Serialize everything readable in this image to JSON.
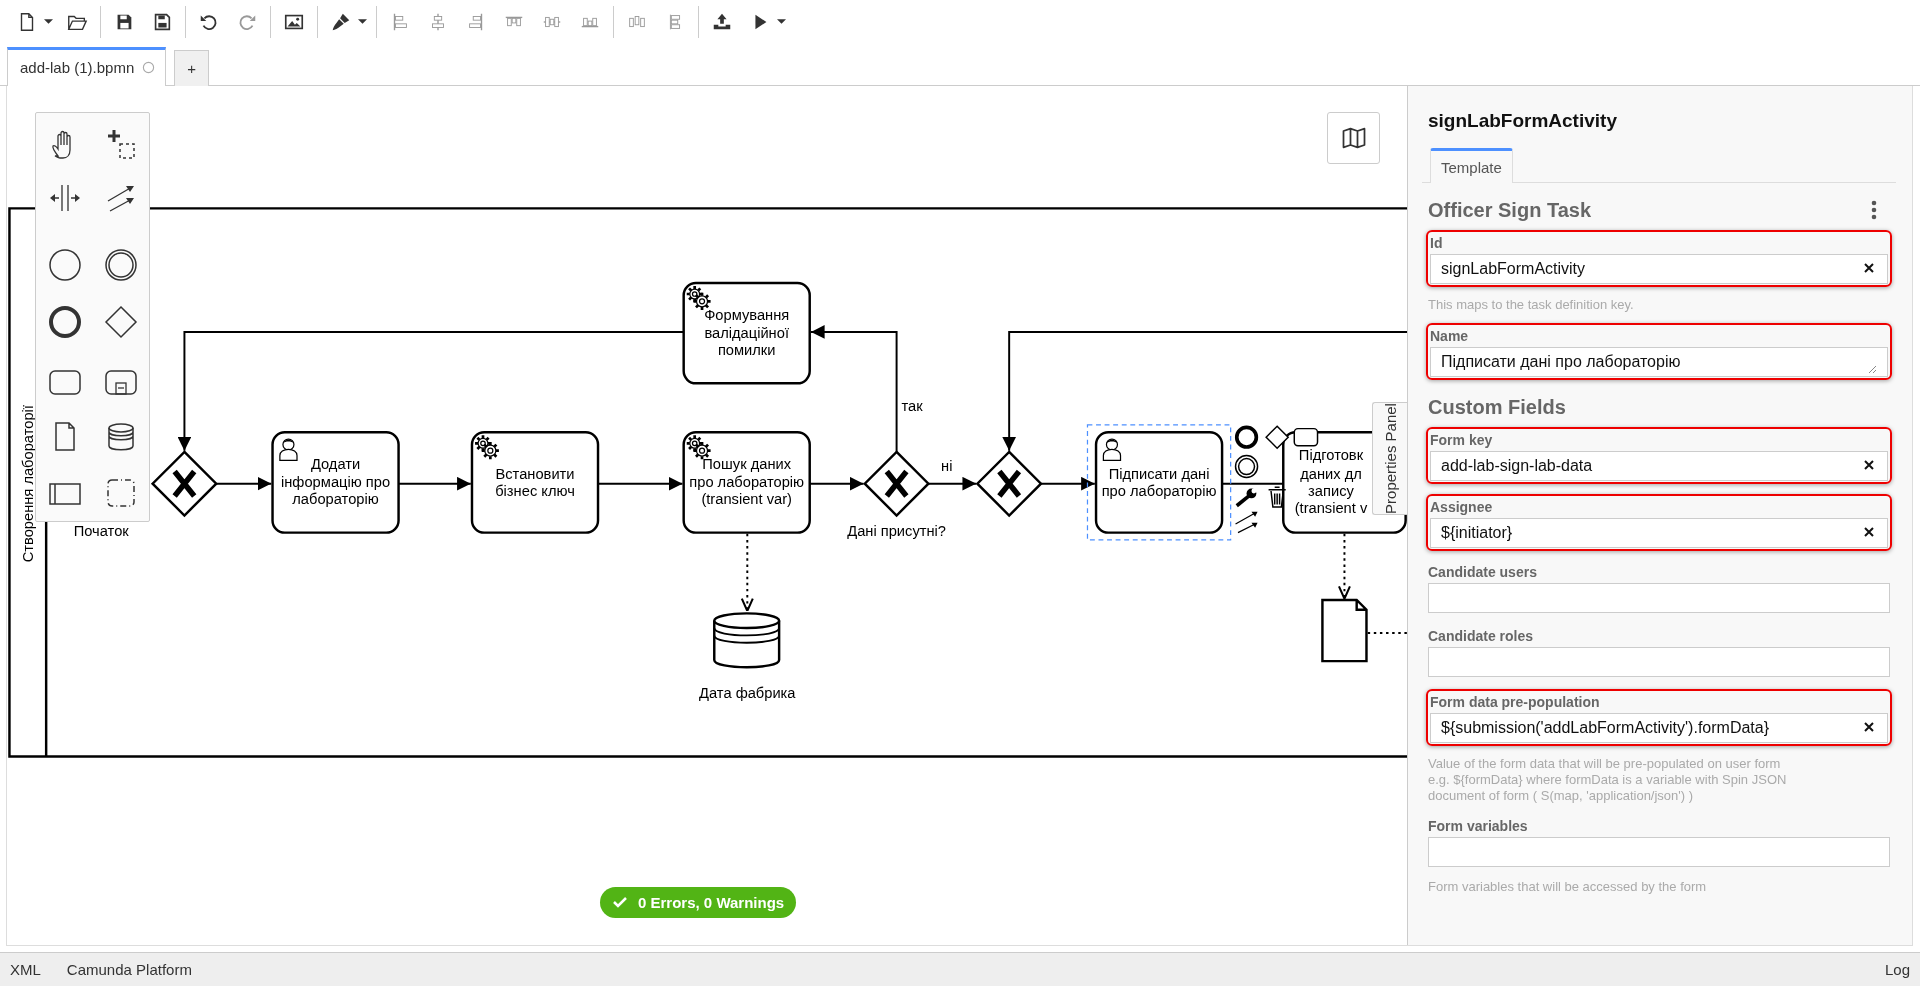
{
  "tabs": [
    {
      "label": "add-lab (1).bpmn",
      "selected": true,
      "unsaved": true
    },
    {
      "label": "+",
      "selected": false,
      "unsaved": false
    }
  ],
  "diagram": {
    "lane": "Створення лабораторії",
    "start_label": "Початок",
    "tasks": [
      {
        "kind": "user",
        "label": "Додати інформацію про лабораторію",
        "selected": false
      },
      {
        "kind": "service",
        "label": "Встановити бізнес ключ",
        "selected": false
      },
      {
        "kind": "service",
        "label": "Формування валідаційної помилки",
        "selected": false
      },
      {
        "kind": "service",
        "label": "Пошук даних про лабораторію (transient var)",
        "selected": false
      },
      {
        "kind": "user",
        "label": "Підписати дані про лабораторію",
        "selected": true
      },
      {
        "kind": "plain",
        "label": "Підготовк даних дл запису (transient v",
        "selected": false
      }
    ],
    "gateway_label": "Дані присутні?",
    "flow_yes": "так",
    "flow_no": "ні",
    "datastore_label": "Дата фабрика",
    "properties_toggle": "Properties Panel",
    "validation": "0 Errors, 0 Warnings"
  },
  "properties": {
    "title": "signLabFormActivity",
    "tabs": [
      {
        "label": "Template",
        "selected": true
      }
    ],
    "sections": [
      {
        "title": "Officer Sign Task",
        "menu": true,
        "fields": [
          {
            "label": "Id",
            "value": "signLabFormActivity",
            "kind": "input",
            "clearable": true,
            "highlighted": true,
            "description": [
              "This maps to the task definition key."
            ]
          },
          {
            "label": "Name",
            "value": "Підписати дані про лабораторію",
            "kind": "textarea",
            "clearable": false,
            "highlighted": true
          }
        ]
      },
      {
        "title": "Custom Fields",
        "menu": false,
        "fields": [
          {
            "label": "Form key",
            "value": "add-lab-sign-lab-data",
            "kind": "input",
            "clearable": true,
            "highlighted": true
          },
          {
            "label": "Assignee",
            "value": "${initiator}",
            "kind": "input",
            "clearable": true,
            "highlighted": true
          },
          {
            "label": "Candidate users",
            "kind": "input",
            "clearable": false,
            "highlighted": false
          },
          {
            "label": "Candidate roles",
            "kind": "input",
            "clearable": false,
            "highlighted": false
          },
          {
            "label": "Form data pre-population",
            "value": "${submission('addLabFormActivity').formData}",
            "kind": "input",
            "clearable": true,
            "highlighted": true,
            "description": [
              "Value of the form data that will be pre-populated on user form",
              "e.g. ${formData} where formData is a variable with Spin JSON",
              "document of form ( S(map, 'application/json') )"
            ]
          },
          {
            "label": "Form variables",
            "kind": "input",
            "clearable": false,
            "highlighted": false,
            "description": [
              "Form variables that will be accessed by the form"
            ]
          }
        ]
      }
    ]
  },
  "status_bar": {
    "left": [
      "XML",
      "Camunda Platform"
    ],
    "right": "Log"
  }
}
